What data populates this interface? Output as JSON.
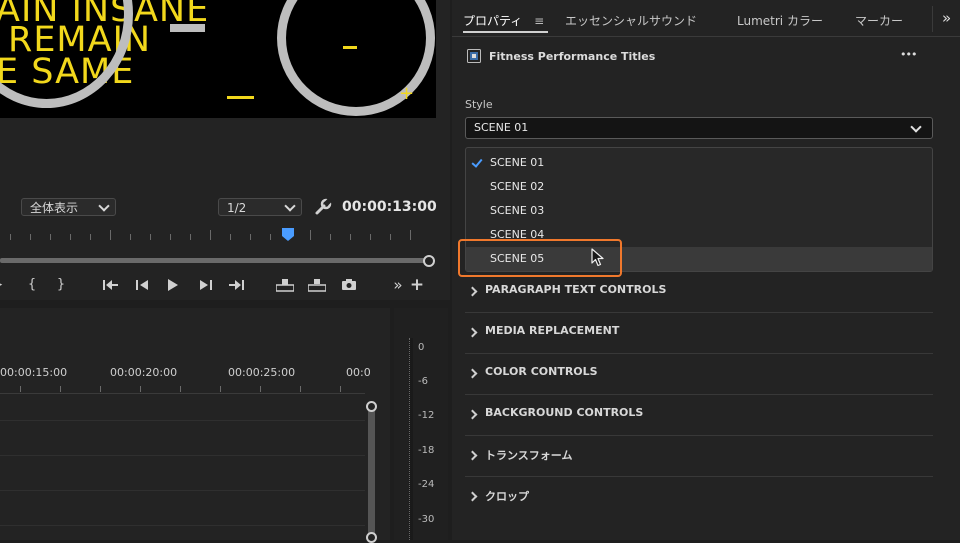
{
  "monitor": {
    "video_lines": [
      "AIN INSANE",
      "REMAIN",
      "E SAME"
    ],
    "fit_dropdown": "全体表示",
    "resolution_dropdown": "1/2",
    "timecode": "00:00:13:00",
    "controls": {
      "mark_in": "{",
      "mark_out": "}",
      "more": "»",
      "add": "+"
    }
  },
  "timeline": {
    "time_labels": [
      "00:00:15:00",
      "00:00:20:00",
      "00:00:25:00",
      "00:0"
    ]
  },
  "meter": {
    "db_labels": [
      "0",
      "-6",
      "-12",
      "-18",
      "-24",
      "-30"
    ]
  },
  "panel": {
    "tabs": [
      "プロパティ",
      "エッセンシャルサウンド",
      "Lumetri カラー",
      "マーカー"
    ],
    "tab_menu_icon": "≡",
    "more_tabs": "»",
    "title": "Fitness Performance Titles",
    "more_menu": "•••",
    "style_label": "Style",
    "style_value": "SCENE 01",
    "style_options": [
      "SCENE 01",
      "SCENE 02",
      "SCENE 03",
      "SCENE 04",
      "SCENE 05"
    ],
    "sections": [
      "PARAGRAPH TEXT CONTROLS",
      "MEDIA REPLACEMENT",
      "COLOR CONTROLS",
      "BACKGROUND CONTROLS",
      "トランスフォーム",
      "クロップ"
    ]
  },
  "colors": {
    "title_yellow": "#f2d81c",
    "accent_blue": "#4a9cff",
    "highlight_orange": "#f0782c"
  }
}
